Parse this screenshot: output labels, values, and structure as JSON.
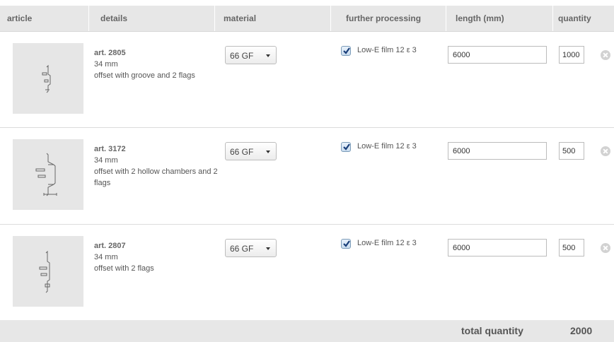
{
  "headers": {
    "article": "article",
    "details": "details",
    "material": "material",
    "further_processing": "further processing",
    "length": "length (mm)",
    "quantity": "quantity"
  },
  "rows": [
    {
      "art": "art. 2805",
      "size": "34 mm",
      "description": "offset with groove and 2 flags",
      "material": "66 GF",
      "processing_checked": true,
      "processing": "Low-E film 12 ε 3",
      "length": "6000",
      "quantity": "1000"
    },
    {
      "art": "art. 3172",
      "size": "34 mm",
      "description": "offset with 2 hollow chambers and 2 flags",
      "material": "66 GF",
      "processing_checked": true,
      "processing": "Low-E film 12 ε 3",
      "length": "6000",
      "quantity": "500"
    },
    {
      "art": "art. 2807",
      "size": "34 mm",
      "description": "offset with 2 flags",
      "material": "66 GF",
      "processing_checked": true,
      "processing": "Low-E film 12 ε 3",
      "length": "6000",
      "quantity": "500"
    }
  ],
  "footer": {
    "total_label": "total quantity",
    "total_value": "2000"
  }
}
